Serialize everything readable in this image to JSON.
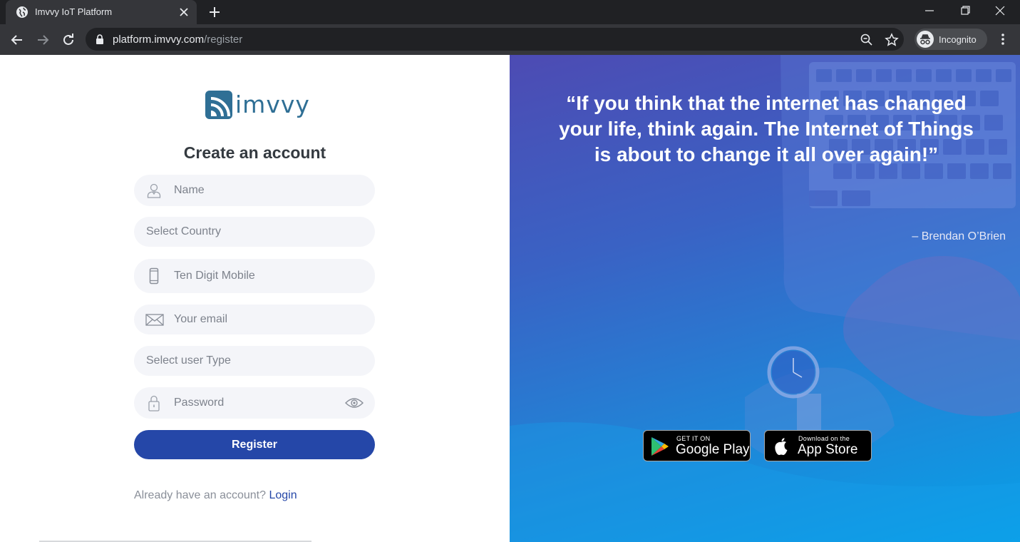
{
  "browser": {
    "tab_title": "Imvvy IoT Platform",
    "url_host": "platform.imvvy.com",
    "url_path": "/register",
    "incognito_label": "Incognito"
  },
  "brand": {
    "logo_text": "imvvy",
    "logo_color": "#2f6f95"
  },
  "form": {
    "title": "Create an account",
    "name_placeholder": "Name",
    "country_placeholder": "Select Country",
    "mobile_placeholder": "Ten Digit Mobile",
    "email_placeholder": "Your email",
    "user_type_placeholder": "Select user Type",
    "password_placeholder": "Password",
    "register_label": "Register",
    "login_prompt": "Already have an account?",
    "login_link": "Login",
    "accent_color": "#2547a8"
  },
  "hero": {
    "quote": "“If you think that the internet has changed your life, think again. The Internet of Things is about to change it all over again!”",
    "author": "– Brendan O’Brien"
  },
  "stores": {
    "google_small": "GET IT ON",
    "google_big": "Google Play",
    "apple_small": "Download on the",
    "apple_big": "App Store"
  },
  "icons": {
    "favicon": "globe-icon",
    "tab_close": "close-icon",
    "new_tab": "plus-icon",
    "back": "arrow-left-icon",
    "forward": "arrow-right-icon",
    "reload": "reload-icon",
    "lock": "lock-icon",
    "zoom": "magnifier-icon",
    "bookmark": "star-icon",
    "incognito": "incognito-icon",
    "menu": "kebab-menu-icon",
    "name": "user-icon",
    "mobile": "phone-icon",
    "email": "envelope-icon",
    "password": "padlock-icon",
    "show_password": "eye-icon"
  }
}
